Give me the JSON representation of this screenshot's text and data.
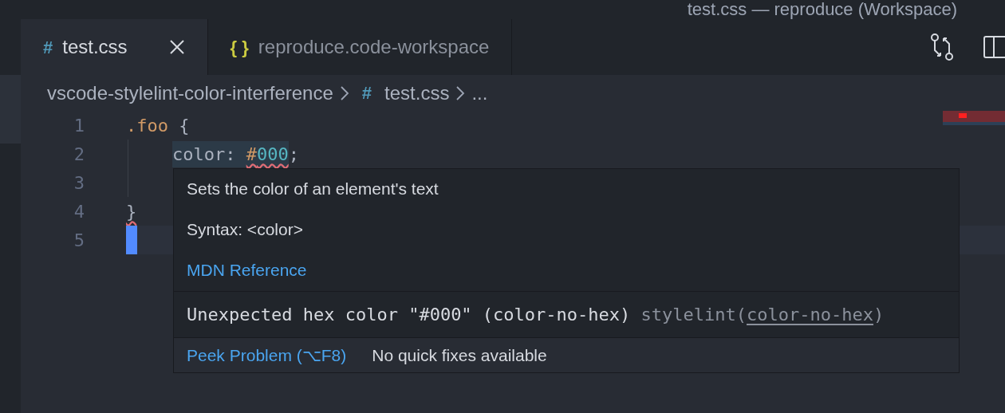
{
  "window": {
    "title": "test.css — reproduce (Workspace)"
  },
  "tabs": [
    {
      "icon": "#",
      "label": "test.css",
      "selected": true,
      "kind": "css"
    },
    {
      "icon": "{ }",
      "label": "reproduce.code-workspace",
      "selected": false,
      "kind": "json"
    }
  ],
  "breadcrumb": [
    {
      "label": "vscode-stylelint-color-interference",
      "kind": "folder"
    },
    {
      "label": "test.css",
      "kind": "file",
      "icon": "#"
    },
    {
      "label": "...",
      "kind": "more"
    }
  ],
  "editor": {
    "lines": [
      {
        "number": "1",
        "current": false,
        "tokens": [
          {
            "text": ".foo",
            "kind": "selector",
            "error": false
          },
          {
            "text": " {",
            "kind": "punct",
            "error": false
          }
        ]
      },
      {
        "number": "2",
        "current": false,
        "indented": true,
        "tokens": [
          {
            "text": "color: ",
            "kind": "property",
            "error": false,
            "hovered": true
          },
          {
            "text": "#",
            "kind": "hash",
            "error": true,
            "hovered": true
          },
          {
            "text": "000",
            "kind": "value",
            "error": true,
            "hovered": true
          },
          {
            "text": ";",
            "kind": "punct",
            "error": false
          }
        ]
      },
      {
        "number": "3",
        "current": false
      },
      {
        "number": "4",
        "current": false,
        "tokens": [
          {
            "text": "}",
            "kind": "punct",
            "error": true
          }
        ]
      },
      {
        "number": "5",
        "current": true
      }
    ]
  },
  "hover": {
    "description": "Sets the color of an element's text",
    "syntax": "Syntax: <color>",
    "reference_link": "MDN Reference",
    "problem": {
      "message": "Unexpected hex color \"#000\" (color-no-hex)",
      "source": "stylelint(",
      "code": "color-no-hex",
      "source_end": ")"
    },
    "actions": [
      {
        "label": "Peek Problem (⌥F8)",
        "kind": "link"
      },
      {
        "label": "No quick fixes available",
        "kind": "text"
      }
    ]
  }
}
